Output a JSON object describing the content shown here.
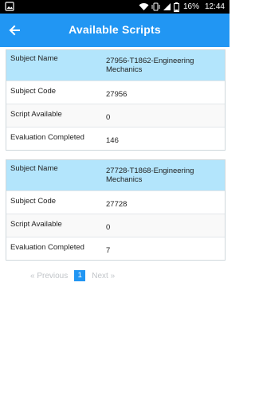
{
  "status_bar": {
    "battery_percent": "16%",
    "time": "12:44"
  },
  "app_bar": {
    "title": "Available Scripts",
    "back_icon": "arrow-left-icon"
  },
  "scripts": [
    {
      "subject_name_label": "Subject Name",
      "subject_name": "27956-T1862-Engineering Mechanics",
      "subject_code_label": "Subject Code",
      "subject_code": "27956",
      "script_available_label": "Script Available",
      "script_available": "0",
      "evaluation_completed_label": "Evaluation Completed",
      "evaluation_completed": "146"
    },
    {
      "subject_name_label": "Subject Name",
      "subject_name": "27728-T1868-Engineering Mechanics",
      "subject_code_label": "Subject Code",
      "subject_code": "27728",
      "script_available_label": "Script Available",
      "script_available": "0",
      "evaluation_completed_label": "Evaluation Completed",
      "evaluation_completed": "7"
    }
  ],
  "pagination": {
    "previous": "« Previous",
    "current_page": "1",
    "next": "Next »"
  },
  "colors": {
    "app_bar": "#2196f3",
    "card_header": "#b3e5fc",
    "status_bar": "#000000"
  }
}
